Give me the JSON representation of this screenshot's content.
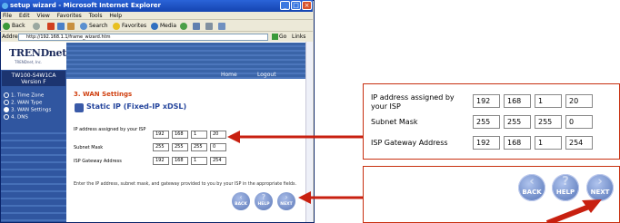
{
  "browser": {
    "title": "setup wizard - Microsoft Internet Explorer",
    "menu": [
      "File",
      "Edit",
      "View",
      "Favorites",
      "Tools",
      "Help"
    ],
    "toolbar": {
      "back": "Back",
      "search": "Search",
      "favorites": "Favorites",
      "media": "Media"
    },
    "address_label": "Address",
    "address_value": "http://192.168.1.1/frame_wizard.htm",
    "go_label": "Go",
    "links_label": "Links"
  },
  "page": {
    "logo": "TRENDnet",
    "logo_sub": "TRENDnet, Inc.",
    "model": "TW100-S4W1CA",
    "version": "Version F",
    "nav": {
      "home": "Home",
      "logout": "Logout"
    },
    "steps": [
      {
        "label": "1. Time Zone",
        "active": false
      },
      {
        "label": "2. WAN Type",
        "active": false
      },
      {
        "label": "3. WAN Settings",
        "active": true
      },
      {
        "label": "4. DNS",
        "active": false
      }
    ],
    "section_title": "3. WAN Settings",
    "static_title": "Static IP (Fixed-IP xDSL)",
    "fields": [
      {
        "label": "IP address assigned by your ISP",
        "octets": [
          "192",
          "168",
          "1",
          "20"
        ]
      },
      {
        "label": "Subnet Mask",
        "octets": [
          "255",
          "255",
          "255",
          "0"
        ]
      },
      {
        "label": "ISP Gateway Address",
        "octets": [
          "192",
          "168",
          "1",
          "254"
        ]
      }
    ],
    "help_text": "Enter the IP address, subnet mask, and gateway provided to you by your ISP in the appropriate fields.",
    "buttons": {
      "back": "BACK",
      "help": "HELP",
      "next": "NEXT"
    }
  },
  "callout": {
    "fields": [
      {
        "label": "IP address assigned by your ISP",
        "octets": [
          "192",
          "168",
          "1",
          "20"
        ]
      },
      {
        "label": "Subnet Mask",
        "octets": [
          "255",
          "255",
          "255",
          "0"
        ]
      },
      {
        "label": "ISP Gateway Address",
        "octets": [
          "192",
          "168",
          "1",
          "254"
        ]
      }
    ],
    "buttons": {
      "back": "BACK",
      "help": "HELP",
      "next": "NEXT"
    }
  },
  "colors": {
    "arrow": "#c82010",
    "accent": "#3056a0"
  }
}
